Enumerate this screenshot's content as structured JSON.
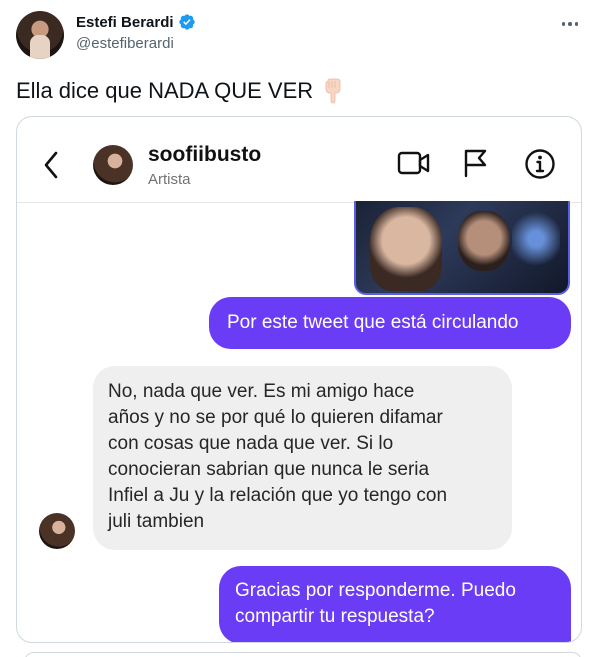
{
  "tweet": {
    "author_name": "Estefi Berardi",
    "handle": "@estefiberardi",
    "text": "Ella dice que NADA QUE VER",
    "emoji_icon": "pointing-down-hand-icon",
    "more_icon": "more-options-icon"
  },
  "screenshot": {
    "contact_name": "soofiibusto",
    "contact_subtitle": "Artista",
    "messages": [
      {
        "from": "me",
        "type": "photo"
      },
      {
        "from": "me",
        "text": "Por este tweet que está circulando"
      },
      {
        "from": "them",
        "text": "No, nada que ver. Es mi amigo hace\naños y no se por qué lo quieren difamar\ncon cosas que nada que ver. Si lo\nconocieran sabrian que nunca le seria\nInfiel a Ju y la relación que yo tengo con\njuli tambien"
      },
      {
        "from": "me",
        "text": "Gracias por responderme. Puedo\ncompartir tu respuesta?"
      }
    ]
  },
  "colors": {
    "verified_blue": "#1d9bf0",
    "outgoing_bubble": "#6b3cf6",
    "incoming_bubble": "#efefef",
    "text_secondary": "#536471"
  }
}
